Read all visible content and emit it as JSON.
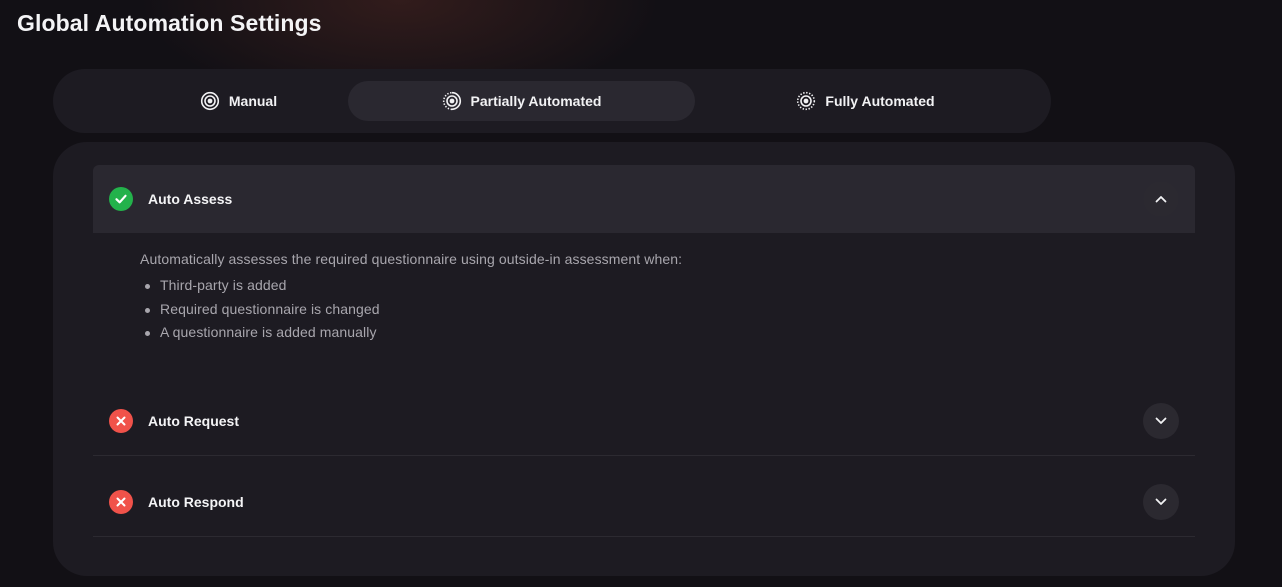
{
  "page": {
    "title": "Global Automation Settings"
  },
  "modes": [
    {
      "label": "Manual",
      "icon": "target-icon",
      "active": false
    },
    {
      "label": "Partially Automated",
      "icon": "partial-target-icon",
      "active": true
    },
    {
      "label": "Fully Automated",
      "icon": "dotted-target-icon",
      "active": false
    }
  ],
  "sections": [
    {
      "title": "Auto Assess",
      "status": "enabled",
      "status_icon": "check-icon",
      "expanded": true,
      "description": "Automatically assesses the required questionnaire using outside-in assessment when:",
      "conditions": [
        "Third-party is added",
        "Required questionnaire is changed",
        "A questionnaire is added manually"
      ]
    },
    {
      "title": "Auto Request",
      "status": "disabled",
      "status_icon": "x-icon",
      "expanded": false
    },
    {
      "title": "Auto Respond",
      "status": "disabled",
      "status_icon": "x-icon",
      "expanded": false
    }
  ],
  "colors": {
    "background": "#121015",
    "panel": "#1d1b22",
    "active_tab": "#2a2830",
    "enabled": "#23b24b",
    "disabled": "#f0524a",
    "muted_text": "#a8a6ad"
  }
}
